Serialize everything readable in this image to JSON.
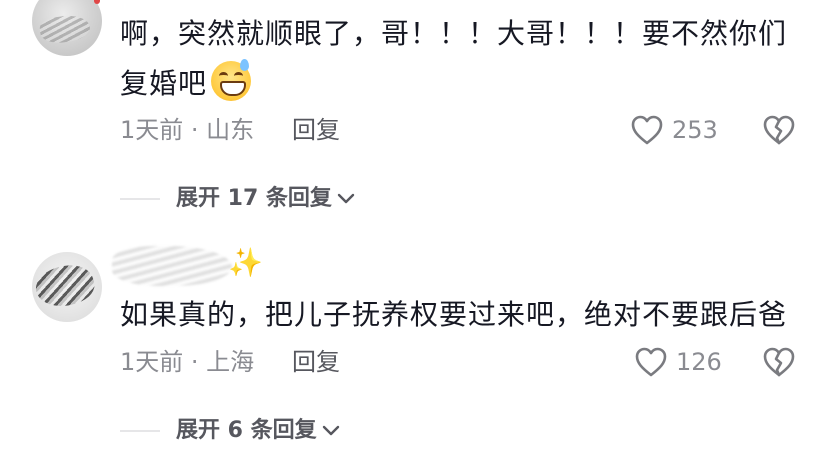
{
  "comments": [
    {
      "text_line1": "啊，突然就顺眼了，哥！！！大哥！！！要不然你们",
      "text_line2": "复婚吧",
      "emoji": "grinning-sweat-emoji",
      "meta": "1天前 · 山东",
      "reply_label": "回复",
      "likes": "253",
      "expand_label": "展开 17 条回复"
    },
    {
      "text": "如果真的，把儿子抚养权要过来吧，绝对不要跟后爸",
      "meta": "1天前 · 上海",
      "reply_label": "回复",
      "likes": "126",
      "expand_label": "展开 6 条回复"
    }
  ],
  "colors": {
    "text": "#161823",
    "meta": "#8a8b91",
    "action": "#56575e",
    "icon": "#7a7b80"
  }
}
